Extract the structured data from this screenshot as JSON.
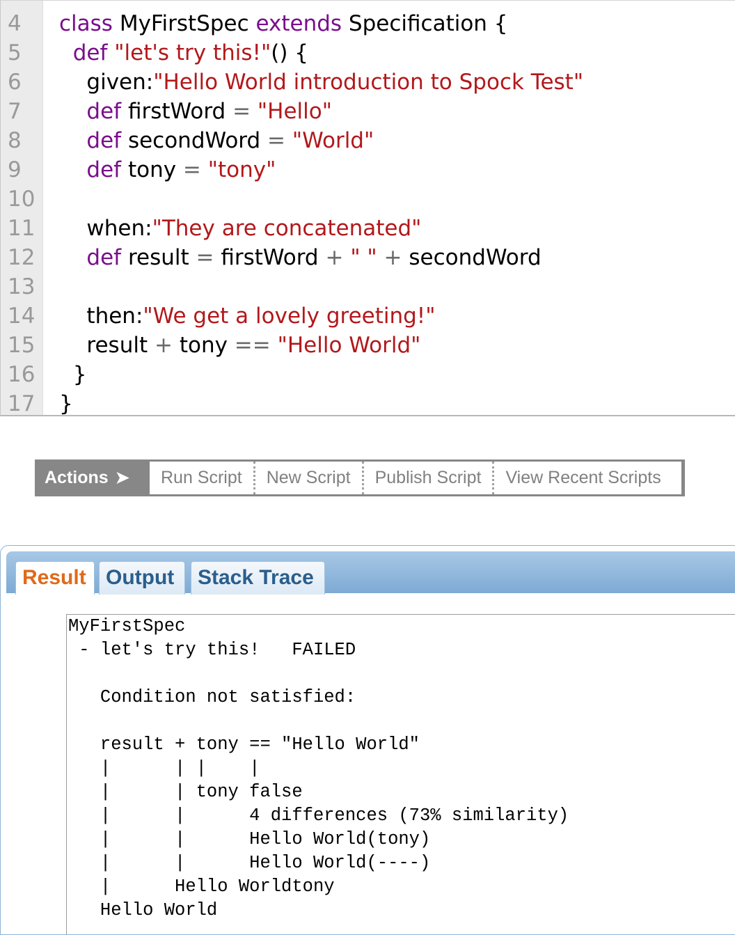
{
  "editor": {
    "lines": [
      {
        "num": "4",
        "segments": [
          {
            "t": "class",
            "c": "kw"
          },
          {
            "t": " MyFirstSpec "
          },
          {
            "t": "extends",
            "c": "kw"
          },
          {
            "t": " Specification {"
          }
        ]
      },
      {
        "num": "5",
        "segments": [
          {
            "t": "  "
          },
          {
            "t": "def",
            "c": "kw"
          },
          {
            "t": " "
          },
          {
            "t": "\"let's try this!\"",
            "c": "str"
          },
          {
            "t": "() {"
          }
        ]
      },
      {
        "num": "6",
        "segments": [
          {
            "t": "    given:"
          },
          {
            "t": "\"Hello World introduction to Spock Test\"",
            "c": "str"
          }
        ]
      },
      {
        "num": "7",
        "segments": [
          {
            "t": "    "
          },
          {
            "t": "def",
            "c": "kw"
          },
          {
            "t": " firstWord "
          },
          {
            "t": "=",
            "c": "op"
          },
          {
            "t": " "
          },
          {
            "t": "\"Hello\"",
            "c": "str"
          }
        ]
      },
      {
        "num": "8",
        "segments": [
          {
            "t": "    "
          },
          {
            "t": "def",
            "c": "kw"
          },
          {
            "t": " secondWord "
          },
          {
            "t": "=",
            "c": "op"
          },
          {
            "t": " "
          },
          {
            "t": "\"World\"",
            "c": "str"
          }
        ]
      },
      {
        "num": "9",
        "segments": [
          {
            "t": "    "
          },
          {
            "t": "def",
            "c": "kw"
          },
          {
            "t": " tony "
          },
          {
            "t": "=",
            "c": "op"
          },
          {
            "t": " "
          },
          {
            "t": "\"tony\"",
            "c": "str"
          }
        ]
      },
      {
        "num": "10",
        "segments": []
      },
      {
        "num": "11",
        "segments": [
          {
            "t": "    when:"
          },
          {
            "t": "\"They are concatenated\"",
            "c": "str"
          }
        ]
      },
      {
        "num": "12",
        "segments": [
          {
            "t": "    "
          },
          {
            "t": "def",
            "c": "kw"
          },
          {
            "t": " result "
          },
          {
            "t": "=",
            "c": "op"
          },
          {
            "t": " firstWord "
          },
          {
            "t": "+",
            "c": "op"
          },
          {
            "t": " "
          },
          {
            "t": "\" \"",
            "c": "str"
          },
          {
            "t": " "
          },
          {
            "t": "+",
            "c": "op"
          },
          {
            "t": " secondWord"
          }
        ]
      },
      {
        "num": "13",
        "segments": []
      },
      {
        "num": "14",
        "segments": [
          {
            "t": "    then:"
          },
          {
            "t": "\"We get a lovely greeting!\"",
            "c": "str"
          }
        ]
      },
      {
        "num": "15",
        "segments": [
          {
            "t": "    result "
          },
          {
            "t": "+",
            "c": "op"
          },
          {
            "t": " tony "
          },
          {
            "t": "==",
            "c": "op"
          },
          {
            "t": " "
          },
          {
            "t": "\"Hello World\"",
            "c": "str"
          }
        ]
      },
      {
        "num": "16",
        "segments": [
          {
            "t": "  }"
          }
        ]
      },
      {
        "num": "17",
        "segments": [
          {
            "t": "}"
          }
        ]
      }
    ]
  },
  "actions": {
    "label": "Actions",
    "arrow": "➤",
    "items": [
      "Run Script",
      "New Script",
      "Publish Script",
      "View Recent Scripts"
    ]
  },
  "result_panel": {
    "tabs": [
      "Result",
      "Output",
      "Stack Trace"
    ],
    "active_tab": "Result",
    "text_lines": [
      "MyFirstSpec",
      " - let's try this!   FAILED",
      "",
      "   Condition not satisfied:",
      "",
      "   result + tony == \"Hello World\"",
      "   |      | |    |",
      "   |      | tony false",
      "   |      |      4 differences (73% similarity)",
      "   |      |      Hello World(tony)",
      "   |      |      Hello World(----)",
      "   |      Hello Worldtony",
      "   Hello World"
    ]
  }
}
